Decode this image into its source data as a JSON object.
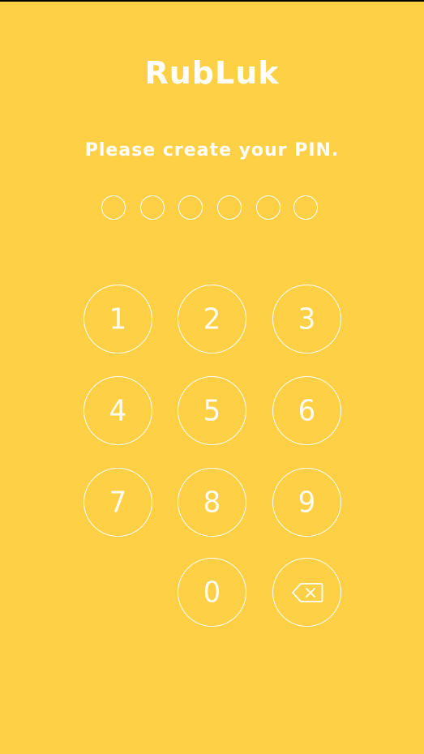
{
  "app": {
    "title": "RubLuk"
  },
  "pin_entry": {
    "prompt": "Please create your PIN.",
    "pin_length": 6,
    "digits_entered": 0
  },
  "keypad": {
    "keys": [
      "1",
      "2",
      "3",
      "4",
      "5",
      "6",
      "7",
      "8",
      "9",
      "0"
    ],
    "delete_icon": "backspace-icon"
  },
  "colors": {
    "background": "#FED045",
    "foreground": "#FFFFFF"
  }
}
